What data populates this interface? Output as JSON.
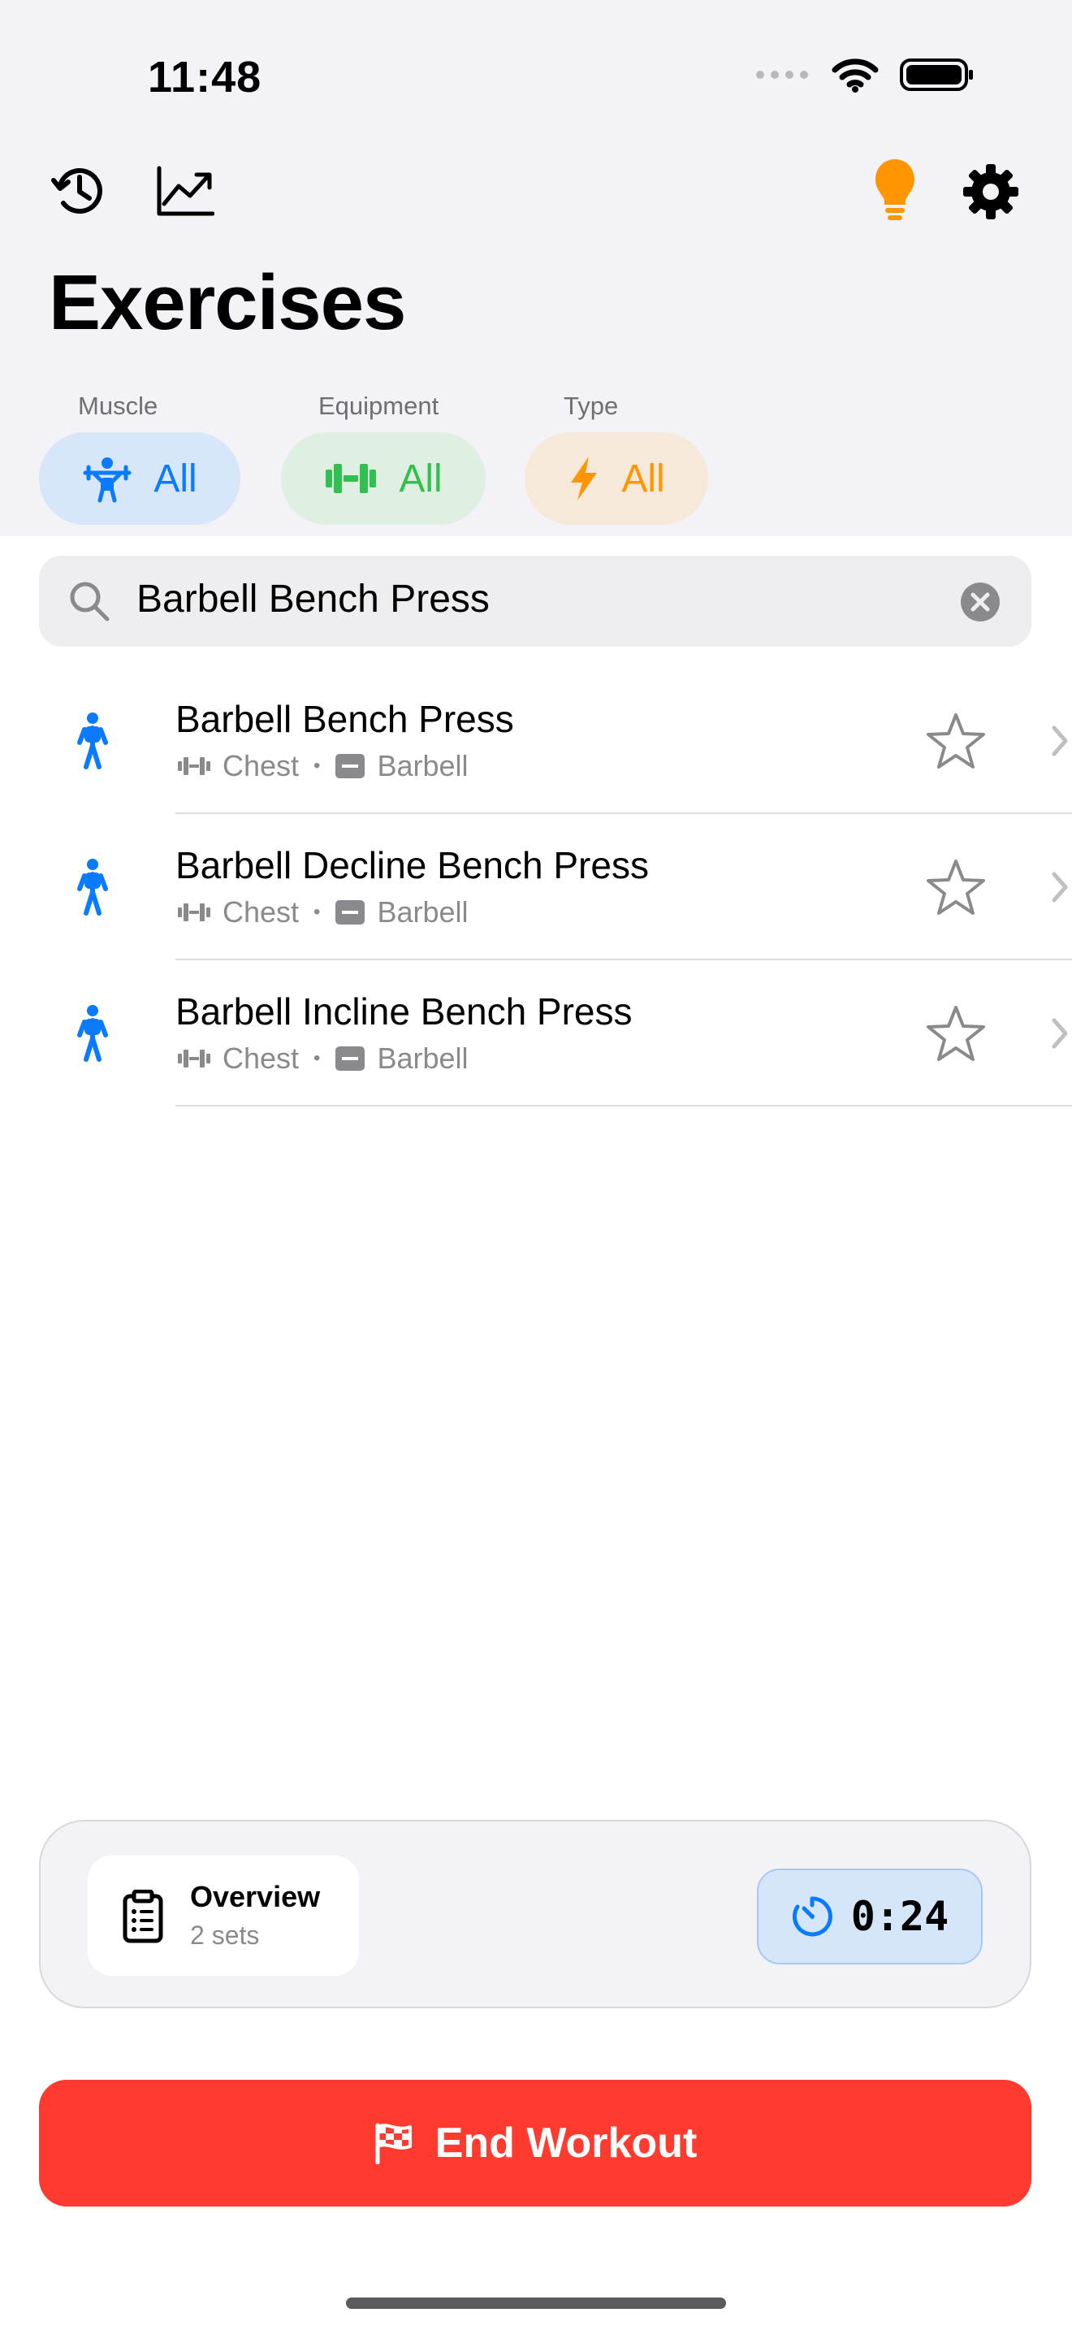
{
  "status_bar": {
    "time": "11:48",
    "icons": [
      "cellular-signal-icon",
      "wifi-icon",
      "battery-icon"
    ]
  },
  "toolbar": {
    "left_icons": [
      "history-icon",
      "chart-icon"
    ],
    "right_icons": [
      "lightbulb-icon",
      "settings-gear-icon"
    ]
  },
  "page_title": "Exercises",
  "filters": [
    {
      "label": "Muscle",
      "value": "All",
      "icon": "weightlifter-icon",
      "color": "#0a7aff",
      "bg": "#d7e6f9"
    },
    {
      "label": "Equipment",
      "value": "All",
      "icon": "dumbbell-icon",
      "color": "#30c04f",
      "bg": "#dff0e3"
    },
    {
      "label": "Type",
      "value": "All",
      "icon": "lightning-icon",
      "color": "#ff9500",
      "bg": "#f6e9da"
    }
  ],
  "search": {
    "value": "Barbell Bench Press",
    "placeholder": ""
  },
  "exercises": [
    {
      "name": "Barbell Bench Press",
      "muscle": "Chest",
      "equipment": "Barbell"
    },
    {
      "name": "Barbell Decline Bench Press",
      "muscle": "Chest",
      "equipment": "Barbell"
    },
    {
      "name": "Barbell Incline Bench Press",
      "muscle": "Chest",
      "equipment": "Barbell"
    }
  ],
  "overview": {
    "title": "Overview",
    "subtitle": "2 sets"
  },
  "timer": {
    "value": "0:24"
  },
  "end_workout": {
    "label": "End Workout"
  },
  "colors": {
    "accent_blue": "#0a7aff",
    "accent_green": "#30c04f",
    "accent_orange": "#ff9500",
    "danger_red": "#ff3b30"
  }
}
